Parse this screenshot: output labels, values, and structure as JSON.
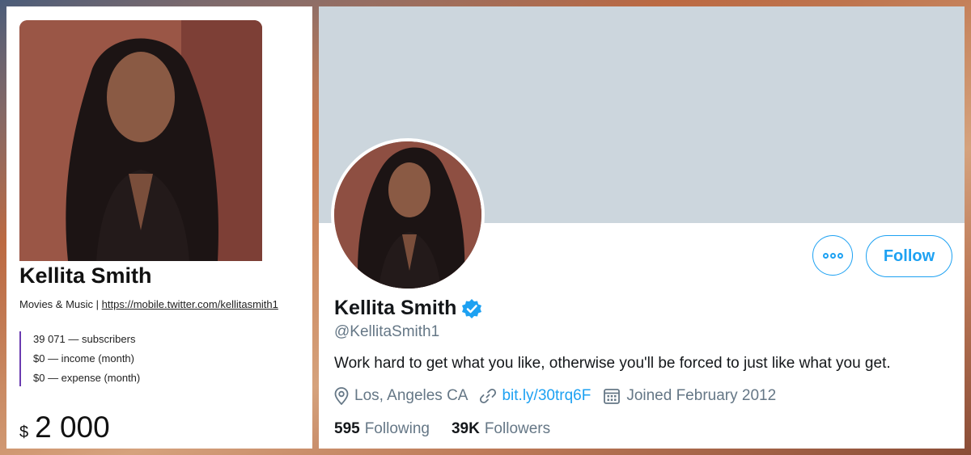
{
  "left": {
    "name": "Kellita Smith",
    "category": "Movies & Music",
    "separator": "|",
    "url": "https://mobile.twitter.com/kellitasmith1",
    "stats": [
      "39 071 — subscribers",
      "$0 — income (month)",
      "$0 — expense (month)"
    ],
    "currency": "$",
    "price": "2 000"
  },
  "profile": {
    "name": "Kellita Smith",
    "handle": "@KellitaSmith1",
    "bio": "Work hard to get what you like, otherwise you'll be forced to just like what you get.",
    "location": "Los, Angeles CA",
    "link": "bit.ly/30trq6F",
    "joined": "Joined February 2012",
    "following_count": "595",
    "following_label": "Following",
    "followers_count": "39K",
    "followers_label": "Followers",
    "follow_label": "Follow"
  },
  "colors": {
    "accent": "#1da1f2",
    "banner": "#ccd6dd",
    "stats_border": "#6a3bb0"
  }
}
